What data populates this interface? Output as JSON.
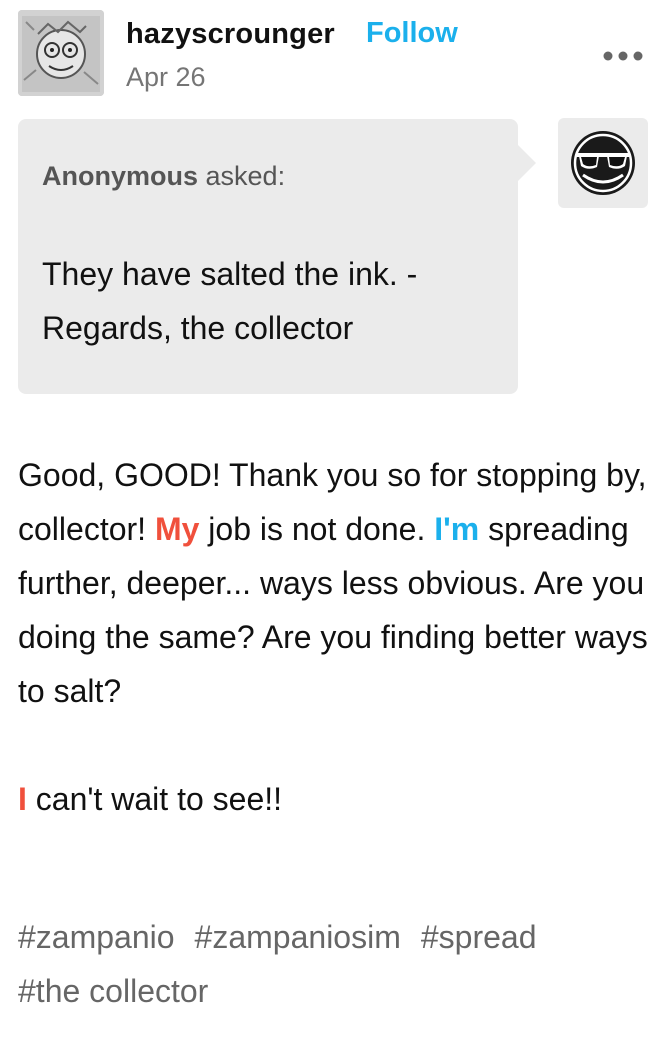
{
  "post": {
    "username": "hazyscrounger",
    "follow_label": "Follow",
    "date": "Apr 26",
    "more_icon": "ellipsis-icon"
  },
  "ask": {
    "asker": "Anonymous",
    "asked_suffix": " asked:",
    "question": "They have salted the ink. - Regards, the collector",
    "anon_icon": "anonymous-sunglasses-avatar"
  },
  "answer": {
    "p1_a": "Good, GOOD! Thank you so for stopping by, collector! ",
    "p1_my": "My",
    "p1_b": " job is not done. ",
    "p1_im": "I'm",
    "p1_c": " spreading further, deeper... ways less obvious. Are you doing the same? Are you finding better ways to salt?",
    "p2_i": "I",
    "p2_rest": " can't wait to see!!"
  },
  "tags": [
    "#zampanio",
    "#zampaniosim",
    "#spread",
    "#the collector"
  ],
  "colors": {
    "accent_blue": "#1bb0ec",
    "accent_red": "#f0503c",
    "bubble_bg": "#ebebeb"
  }
}
